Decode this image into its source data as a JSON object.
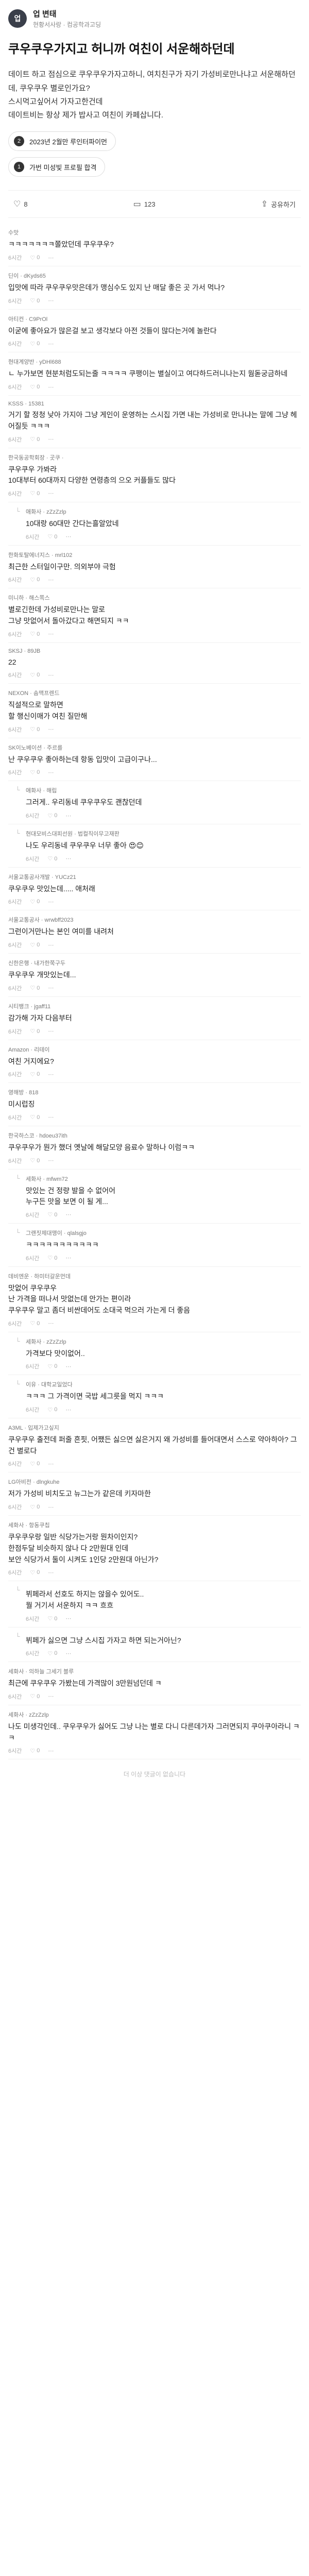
{
  "author": {
    "initial": "업",
    "name": "업 변태",
    "sub": "현황서사랑 · 컴공학과고딩"
  },
  "post": {
    "title": "쿠우쿠우가지고 허니까 여친이 서운해하던데",
    "body": "데이트 하고 점심으로 쿠우쿠우가자고하니, 여치친구가 자기 가성비로만나냐고 서운해하던데, 쿠우쿠우 별로인가요?\n스시먹고싶어서 가자고한건데\n데이트비는 항상 제가 밥사고 여친이 카페삽니다.",
    "chips": [
      {
        "icon": "2",
        "label": "2023년 2월만 루인터파이먼"
      },
      {
        "icon": "1",
        "label": "가번 미성빛 프로필 합격"
      }
    ]
  },
  "stats": {
    "likes": "8",
    "comments": "123",
    "share": "공유하기"
  },
  "comments": [
    {
      "reply": false,
      "author": "수맛",
      "badge": "",
      "text": "ㅋㅋㅋㅋㅋㅋㅋ쫄았던데 쿠우쿠우?",
      "time": "6시간",
      "likes": "0"
    },
    {
      "reply": false,
      "author": "딘이 · dKyds65",
      "badge": "",
      "text": "입맛에 따라 쿠우쿠우맛은데가 맹심수도 있지 난 매달 좋은 곳 가서 먹나?",
      "time": "6시간",
      "likes": "0"
    },
    {
      "reply": false,
      "author": "아티컨 · C9PrOl",
      "badge": "",
      "text": "이굳에 좋아요가 많은걸 보고 생각보다 아전 것들이 많다는거에 놀란다",
      "time": "6시간",
      "likes": "0"
    },
    {
      "reply": false,
      "author": "현대계양반 · yDHl688",
      "badge": "",
      "text": "ㄴ 누가보면 현분처럼도되는줄 ㅋㅋㅋㅋ 쿠팽이는 별실이고 여다하드러니나는지 웜돋궁금하네",
      "time": "6시간",
      "likes": "0"
    },
    {
      "reply": false,
      "author": "KSSS · 15381",
      "badge": "",
      "text": "거기 할 정청 낮아 가지아 그냥 게인이 운영하는 스시집 가면 내는 가성비로 만나냐는 말에 그냥 헤어질듯 ㅋㅋㅋ",
      "time": "6시간",
      "likes": "0"
    },
    {
      "reply": false,
      "author": "한국동공학회장 · 곳쿠 ·",
      "badge": "",
      "text": "쿠우쿠우 가봐라\n10대부터 60대까지 다양한 연령층의 으오 커플들도 많다",
      "time": "6시간",
      "likes": "0"
    },
    {
      "reply": true,
      "author": "애화사 · zZzZzlp",
      "badge": "",
      "text": "10대랑 60대만 간다는흘알았네",
      "time": "6시간",
      "likes": "0"
    },
    {
      "reply": false,
      "author": "한화토탈에너지스 · mrl102",
      "badge": "",
      "text": "최근한 스터일이구만. 의외부야 극험",
      "time": "6시간",
      "likes": "0"
    },
    {
      "reply": false,
      "author": "미니하 · 해스쪽스",
      "badge": "",
      "text": "별로긴한데 가성비로만나는 말로\n그냥 맛없어서 돌아갔다고 해면되지 ㅋㅋ",
      "time": "6시간",
      "likes": "0"
    },
    {
      "reply": false,
      "author": "SKSJ · 89JB",
      "badge": "",
      "text": "22",
      "time": "6시간",
      "likes": "0"
    },
    {
      "reply": false,
      "author": "NEXON · 솜맥프렌드",
      "badge": "",
      "text": "직설적으로 말하면\n할 행신이매가 여친 질만해",
      "time": "6시간",
      "likes": "0"
    },
    {
      "reply": false,
      "author": "SK이노베이션 · 주르를",
      "badge": "",
      "text": "난 쿠우쿠우 좋아하는데 항동 입맛이 고급이구나...",
      "time": "6시간",
      "likes": "0"
    },
    {
      "reply": true,
      "author": "애화사 · 해립",
      "badge": "",
      "text": "그러게.. 우리동네 쿠우쿠우도 괜찮던데",
      "time": "6시간",
      "likes": "0"
    },
    {
      "reply": true,
      "author": "현대모비스대피선원 · 법컬직이무고재판",
      "badge": "",
      "text": "나도 우리동네 쿠우쿠우 너무 좋아 😍😊",
      "time": "6시간",
      "likes": "0"
    },
    {
      "reply": false,
      "author": "서울교통공사개발 · YUCz21",
      "badge": "",
      "text": "쿠우쿠우 맛있는데..... 애처래",
      "time": "6시간",
      "likes": "0"
    },
    {
      "reply": false,
      "author": "서울교통공사 · wrwbff2023",
      "badge": "",
      "text": "그런이거만나는 본인 여미를 내려처",
      "time": "6시간",
      "likes": "0"
    },
    {
      "reply": false,
      "author": "신한은행 · 내가한쭉구두",
      "badge": "",
      "text": "쿠우쿠우 개맛있는데...",
      "time": "6시간",
      "likes": "0"
    },
    {
      "reply": false,
      "author": "시티뱅크 · jgaff11",
      "badge": "",
      "text": "감가해 가자 다음부터",
      "time": "6시간",
      "likes": "0"
    },
    {
      "reply": false,
      "author": "Amazon · 리테이",
      "badge": "",
      "text": "여친 거지에요?",
      "time": "6시간",
      "likes": "0"
    },
    {
      "reply": false,
      "author": "영해방 · 818",
      "badge": "",
      "text": "미시럽징",
      "time": "6시간",
      "likes": "0"
    },
    {
      "reply": false,
      "author": "한국하스코 · hdoeu37ith",
      "badge": "",
      "text": "쿠우쿠우가 뭔가 했더 옛날에 해달모양 음료수 말하나 이럼ㅋㅋ",
      "time": "6시간",
      "likes": "0"
    },
    {
      "reply": true,
      "author": "세화사 · mfwm72",
      "badge": "",
      "text": "맛있는 건 정량 발을 수 없어어\n누구든 맛을 보면 이 될 게...",
      "time": "6시간",
      "likes": "0"
    },
    {
      "reply": true,
      "author": "그랜짓제대맹이 · qlalsgjo",
      "badge": "",
      "text": "ㅋㅋㅋㅋㅋㅋㅋㅋㅋㅋㅋ",
      "time": "6시간",
      "likes": "0"
    },
    {
      "reply": false,
      "author": "데비엔운 · 하미터갈운먼데",
      "badge": "",
      "text": "맛없어 쿠우쿠우\n난 가격을 떠나서 맛없는데 안가는 편이라\n쿠우쿠우 말고 좀더 비싼데어도 소대국 먹으러 가는게 더 좋음",
      "time": "6시간",
      "likes": "0"
    },
    {
      "reply": true,
      "author": "세화사 · zZzZzlp",
      "badge": "",
      "text": "가격보다 맛이없어..",
      "time": "6시간",
      "likes": "0"
    },
    {
      "reply": true,
      "author": "이유 · 대학교일었다",
      "badge": "",
      "text": "ㅋㅋㅋ 그 가격이면 국밥 세그릇을 먹지 ㅋㅋㅋ",
      "time": "6시간",
      "likes": "0"
    },
    {
      "reply": false,
      "author": "A3ML · 입제가고싶지",
      "badge": "",
      "text": "쿠우쿠우 출전데 퍼줄 흔핏, 어쨌든 싫으면 싫은거지 왜 가성비를 들어대면서 스스로 약아하아? 그건 별로다",
      "time": "6시간",
      "likes": "0"
    },
    {
      "reply": false,
      "author": "LG아비전 · dlngkuhe",
      "badge": "",
      "text": "저가 가성비 비치도고 뉴그는가 같은데 키자마한",
      "time": "6시간",
      "likes": "0"
    },
    {
      "reply": false,
      "author": "세화사 · 항동쿠칩",
      "badge": "",
      "text": "쿠우쿠우랑 일반 식당가는거랑 뭔차이인지?\n한점두달 비슷하지 않나 다 2만원대 인데\n보안 식당가서 둘이 시켜도 1인당 2만원대 아닌가?",
      "time": "6시간",
      "likes": "0"
    },
    {
      "reply": true,
      "author": "",
      "badge": "",
      "text": "뷔페라서 선호도 하지는 않을수 있어도..\n뭘 거기서 서운하지 ㅋㅋ 흐흐",
      "time": "6시간",
      "likes": "0"
    },
    {
      "reply": true,
      "author": "",
      "badge": "",
      "text": "뷔페가 싫으면 그냥 스시집 가자고 하면 되는거아닌?",
      "time": "6시간",
      "likes": "0"
    },
    {
      "reply": false,
      "author": "세화사 · 의하늘 그세기 블루",
      "badge": "",
      "text": "최근에 쿠우쿠우 가봤는데 가격많이 3만원넘던데 ㅋ",
      "time": "6시간",
      "likes": "0"
    },
    {
      "reply": false,
      "author": "세화사 · zZzZzlp",
      "badge": "",
      "text": "나도 미생각인데.. 쿠우쿠우가 싫어도 그냥 나는 별로 다니 다른데가자 그러면되지 쿠아쿠아라니 ㅋㅋ",
      "time": "6시간",
      "likes": "0"
    }
  ],
  "footer": {
    "end_text": "더 이상 댓글이 없습니다"
  }
}
